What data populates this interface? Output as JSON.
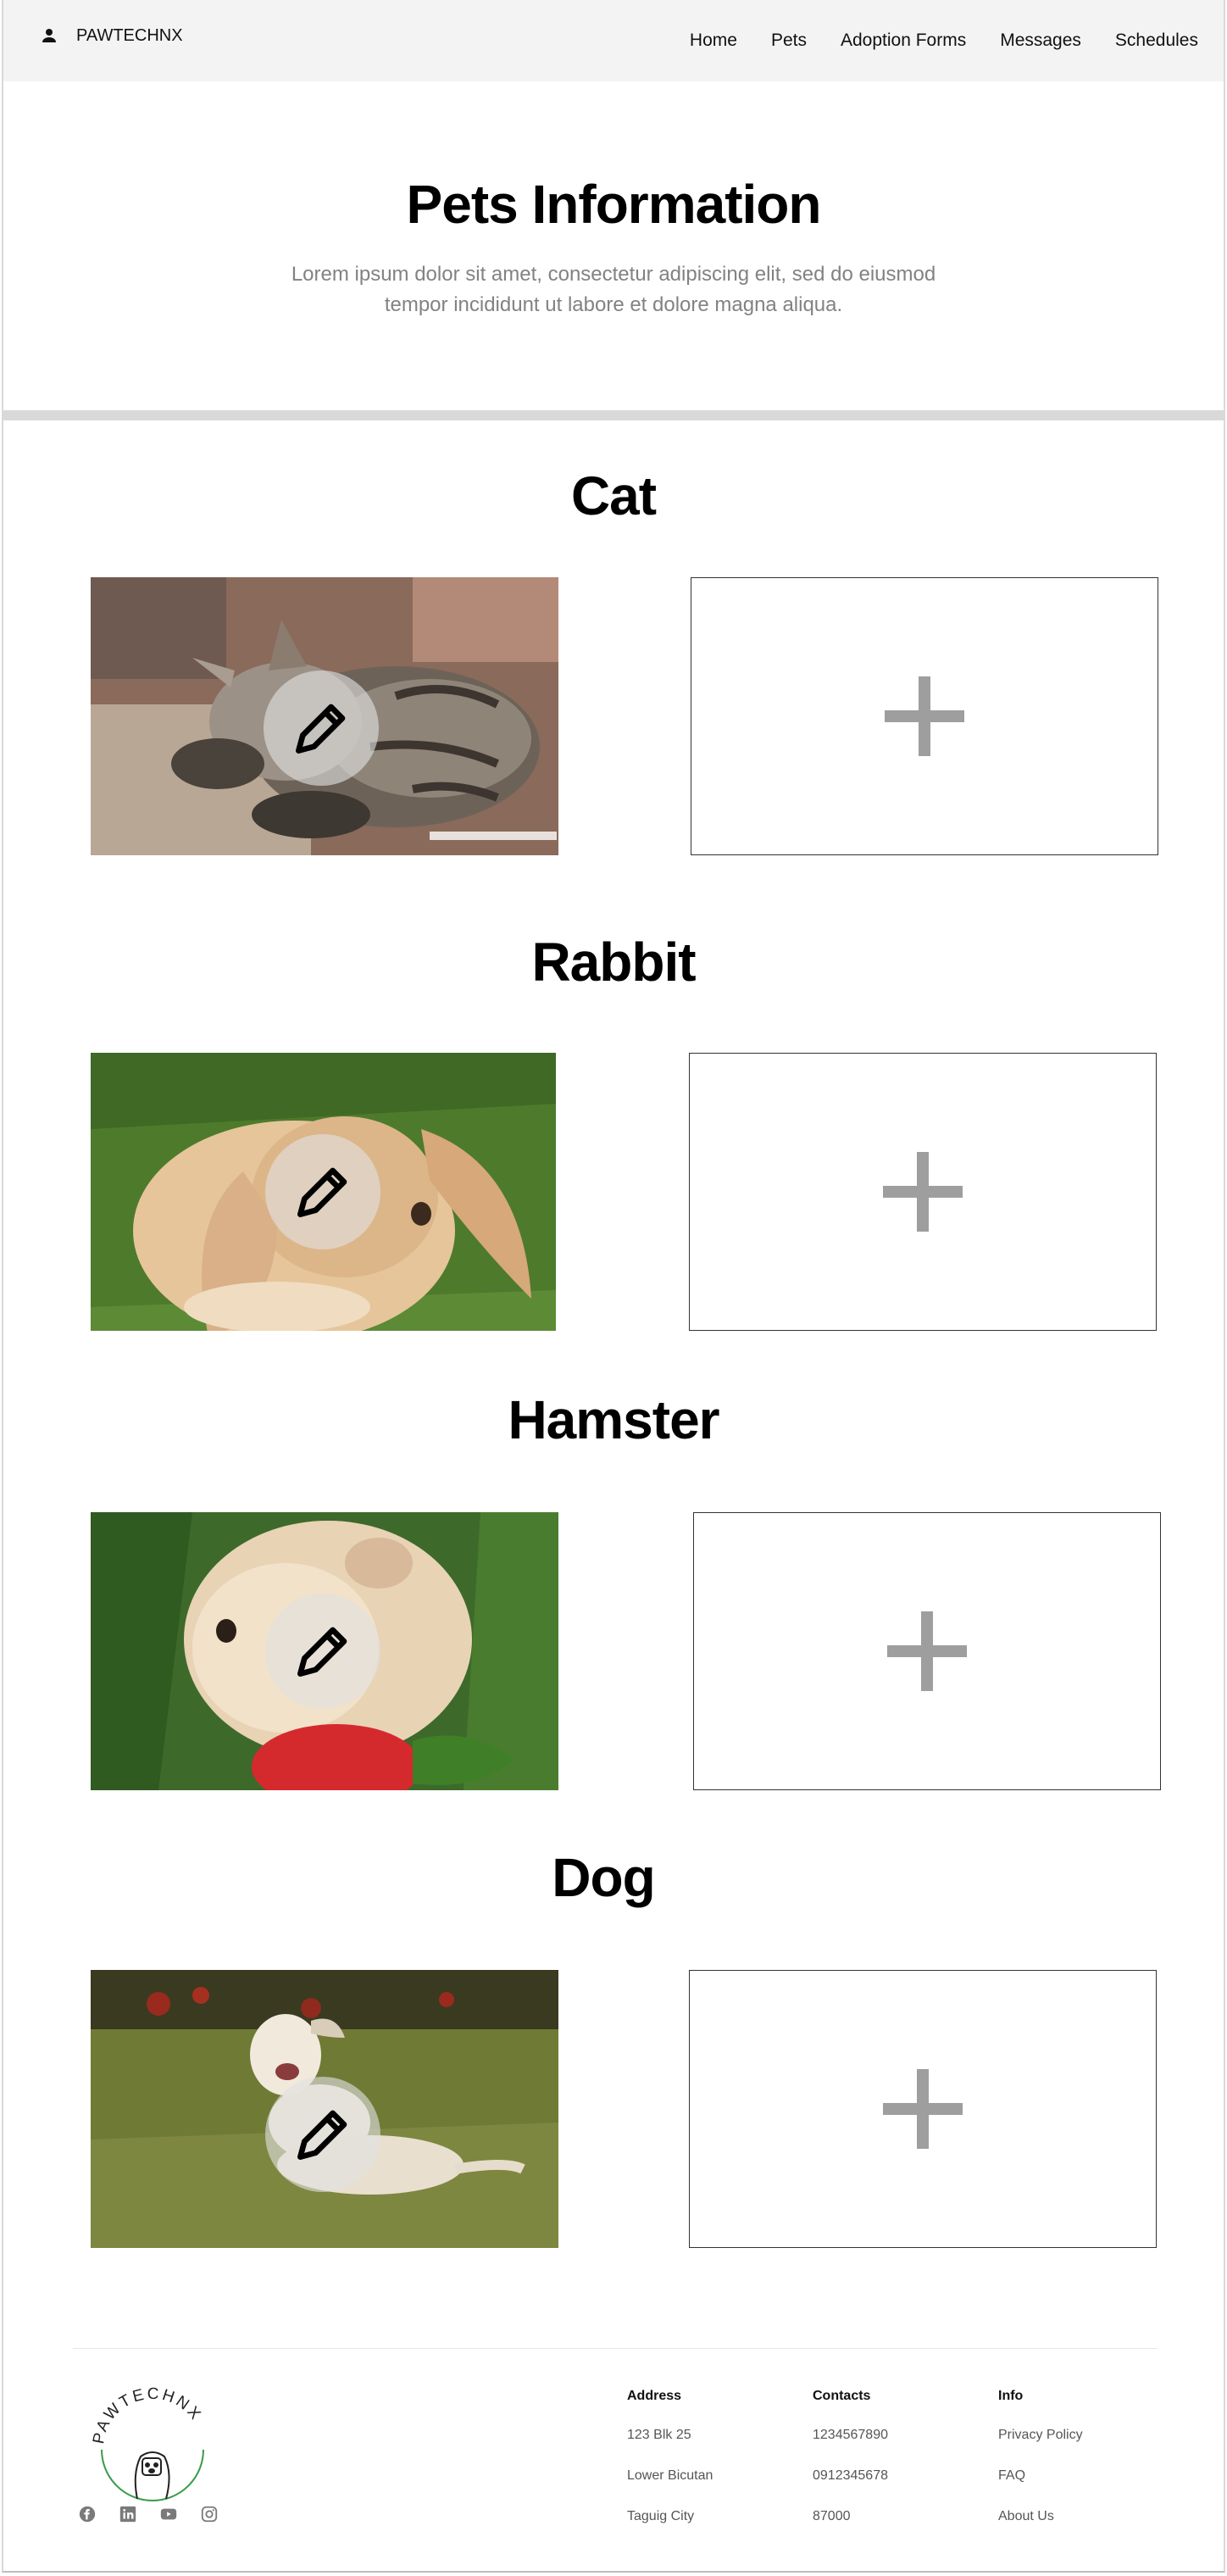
{
  "header": {
    "brand": "PAWTECHNX",
    "nav": [
      "Home",
      "Pets",
      "Adoption Forms",
      "Messages",
      "Schedules"
    ]
  },
  "hero": {
    "title": "Pets Information",
    "subtitle": "Lorem ipsum dolor sit amet, consectetur adipiscing elit, sed do eiusmod tempor incididunt ut labore et dolore magna aliqua."
  },
  "pets": [
    {
      "name": "Cat",
      "photo": "sleeping-kitten-photo"
    },
    {
      "name": "Rabbit",
      "photo": "lop-rabbit-photo"
    },
    {
      "name": "Hamster",
      "photo": "hamster-strawberry-photo"
    },
    {
      "name": "Dog",
      "photo": "dog-on-grass-photo"
    }
  ],
  "icons": {
    "account": "person-icon",
    "edit": "pencil-icon",
    "add": "plus-icon",
    "socials": [
      "facebook-icon",
      "linkedin-icon",
      "youtube-icon",
      "instagram-icon"
    ]
  },
  "footer": {
    "logo_text": "PAWTECHNX",
    "address": {
      "heading": "Address",
      "lines": [
        "123 Blk 25",
        "Lower Bicutan",
        "Taguig City"
      ]
    },
    "contacts": {
      "heading": "Contacts",
      "lines": [
        "1234567890",
        "0912345678",
        "87000"
      ]
    },
    "info": {
      "heading": "Info",
      "links": [
        "Privacy Policy",
        "FAQ",
        "About Us"
      ]
    }
  },
  "colors": {
    "header_bg": "#f3f3f3",
    "muted_text": "#828282",
    "plus": "#9e9e9e",
    "divider": "#d9d9d9"
  }
}
